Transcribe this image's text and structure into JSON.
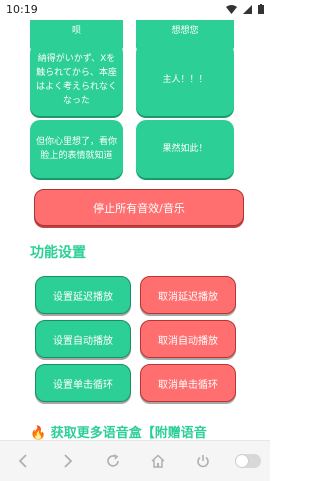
{
  "status_bar": {
    "time": "10:19"
  },
  "cards": [
    {
      "text": "呗"
    },
    {
      "text": "想想您"
    },
    {
      "text": "納得がいかず、Xを触られてから、本座はよく考えられなくなった"
    },
    {
      "text": "主人！！！"
    },
    {
      "text": "但你心里想了，看你脸上的表情就知道"
    },
    {
      "text": "果然如此！"
    }
  ],
  "stop_all_label": "停止所有音效/音乐",
  "section_title": "功能设置",
  "func_buttons": {
    "set_delay": "设置延迟播放",
    "cancel_delay": "取消延迟播放",
    "set_auto": "设置自动播放",
    "cancel_auto": "取消自动播放",
    "set_loop": "设置单击循环",
    "cancel_loop": "取消单击循环"
  },
  "promo": {
    "icon": "fire-icon",
    "text": "获取更多语音盒【附赠语音"
  },
  "colors": {
    "accent": "#2ccf95",
    "danger": "#ff6f6f"
  },
  "nav_icons": [
    "back-icon",
    "forward-icon",
    "refresh-icon",
    "home-icon",
    "power-icon",
    "toggle-switch"
  ]
}
